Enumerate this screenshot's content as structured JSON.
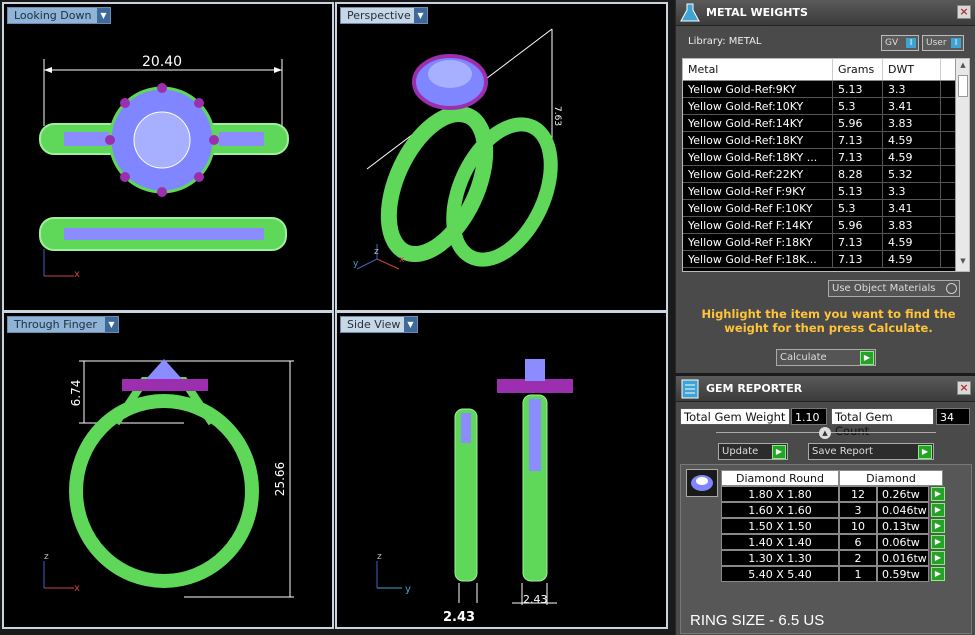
{
  "viewports": {
    "top": {
      "title": "Looking Down",
      "dim_label": "20.40",
      "axis_x": "x"
    },
    "perspective": {
      "title": "Perspective",
      "dim_label": "7.63",
      "axis_z": "z",
      "axis_y": "y",
      "axis_x": "x"
    },
    "front": {
      "title": "Through Finger",
      "dim_height": "6.74",
      "dim_total": "25.66",
      "axis_z": "z",
      "axis_x": "x"
    },
    "side": {
      "title": "Side View",
      "dim_left": "2.43",
      "dim_right": "2.43",
      "axis_z": "z",
      "axis_y": "y"
    }
  },
  "metal_weights": {
    "title": "METAL WEIGHTS",
    "library_label": "Library: METAL",
    "gv_label": "GV",
    "user_label": "User",
    "columns": [
      "Metal",
      "Grams",
      "DWT"
    ],
    "rows": [
      [
        "Yellow Gold-Ref:9KY",
        "5.13",
        "3.3"
      ],
      [
        "Yellow Gold-Ref:10KY",
        "5.3",
        "3.41"
      ],
      [
        "Yellow Gold-Ref:14KY",
        "5.96",
        "3.83"
      ],
      [
        "Yellow Gold-Ref:18KY",
        "7.13",
        "4.59"
      ],
      [
        "Yellow Gold-Ref:18KY ...",
        "7.13",
        "4.59"
      ],
      [
        "Yellow Gold-Ref:22KY",
        "8.28",
        "5.32"
      ],
      [
        "Yellow Gold-Ref F:9KY",
        "5.13",
        "3.3"
      ],
      [
        "Yellow Gold-Ref F:10KY",
        "5.3",
        "3.41"
      ],
      [
        "Yellow Gold-Ref F:14KY",
        "5.96",
        "3.83"
      ],
      [
        "Yellow Gold-Ref F:18KY",
        "7.13",
        "4.59"
      ],
      [
        "Yellow Gold-Ref F:18K...",
        "7.13",
        "4.59"
      ]
    ],
    "use_object_materials": "Use Object Materials",
    "hint": "Highlight the item you want to find the weight for then press Calculate.",
    "calculate_label": "Calculate"
  },
  "gem_reporter": {
    "title": "GEM REPORTER",
    "total_weight_label": "Total Gem Weight",
    "total_weight_value": "1.10",
    "total_count_label": "Total Gem Count",
    "total_count_value": "34",
    "update_label": "Update",
    "save_report_label": "Save Report",
    "headers": [
      "Diamond Round",
      "Diamond"
    ],
    "rows": [
      [
        "1.80 X 1.80",
        "12",
        "0.26tw"
      ],
      [
        "1.60 X 1.60",
        "3",
        "0.046tw"
      ],
      [
        "1.50 X 1.50",
        "10",
        "0.13tw"
      ],
      [
        "1.40 X 1.40",
        "6",
        "0.06tw"
      ],
      [
        "1.30 X 1.30",
        "2",
        "0.016tw"
      ],
      [
        "5.40 X 5.40",
        "1",
        "0.59tw"
      ]
    ],
    "ring_size": "RING SIZE - 6.5 US"
  },
  "colors": {
    "band": "#7ee07a",
    "stone": "#8a8cff",
    "prong": "#9b2fb0",
    "accent": "#3fa4d4"
  }
}
